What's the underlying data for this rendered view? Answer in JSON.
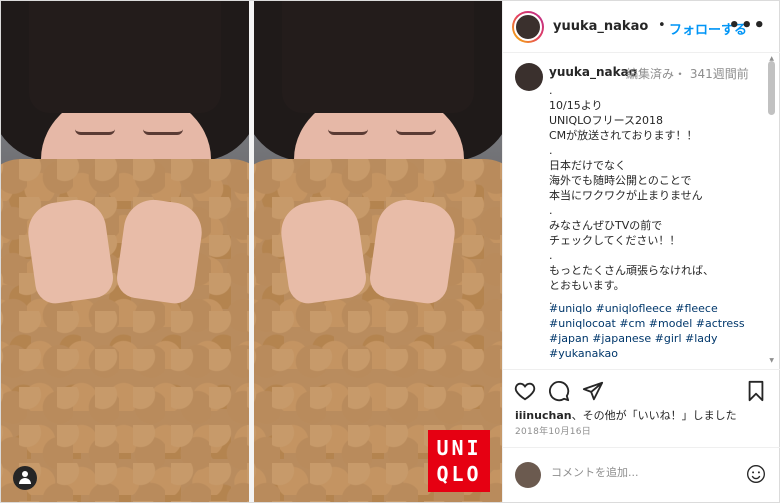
{
  "post": {
    "username": "yuuka_nakao",
    "separator": "•",
    "follow_label": "フォローする",
    "more_label": "•••"
  },
  "media": {
    "brand_logo_text": "UNI QLO"
  },
  "caption": {
    "username": "yuuka_nakao",
    "meta": "編集済み・ 341週間前",
    "body": ".\n10/15より\nUNIQLOフリース2018\nCMが放送されております！！\n.\n日本だけでなく\n海外でも随時公開とのことで\n本当にワクワクが止まりません\n.\nみなさんぜひTVの前で\nチェックしてください！！\n.\nもっとたくさん頑張らなければ、\nとおもいます。\n.",
    "hashtags": "#uniqlo #uniqlofleece #fleece #uniqlocoat #cm #model #actress #japan #japanese #girl #lady #yukanakao"
  },
  "engagement": {
    "liker": "iiinuchan",
    "likes_suffix": "、その他が「いいね！」しました",
    "date": "2018年10月16日"
  },
  "comment_box": {
    "placeholder": "コメントを追加..."
  },
  "icons": [
    "heart-icon",
    "comment-icon",
    "share-icon",
    "bookmark-icon",
    "emoji-icon",
    "more-icon",
    "tag-user-icon"
  ]
}
